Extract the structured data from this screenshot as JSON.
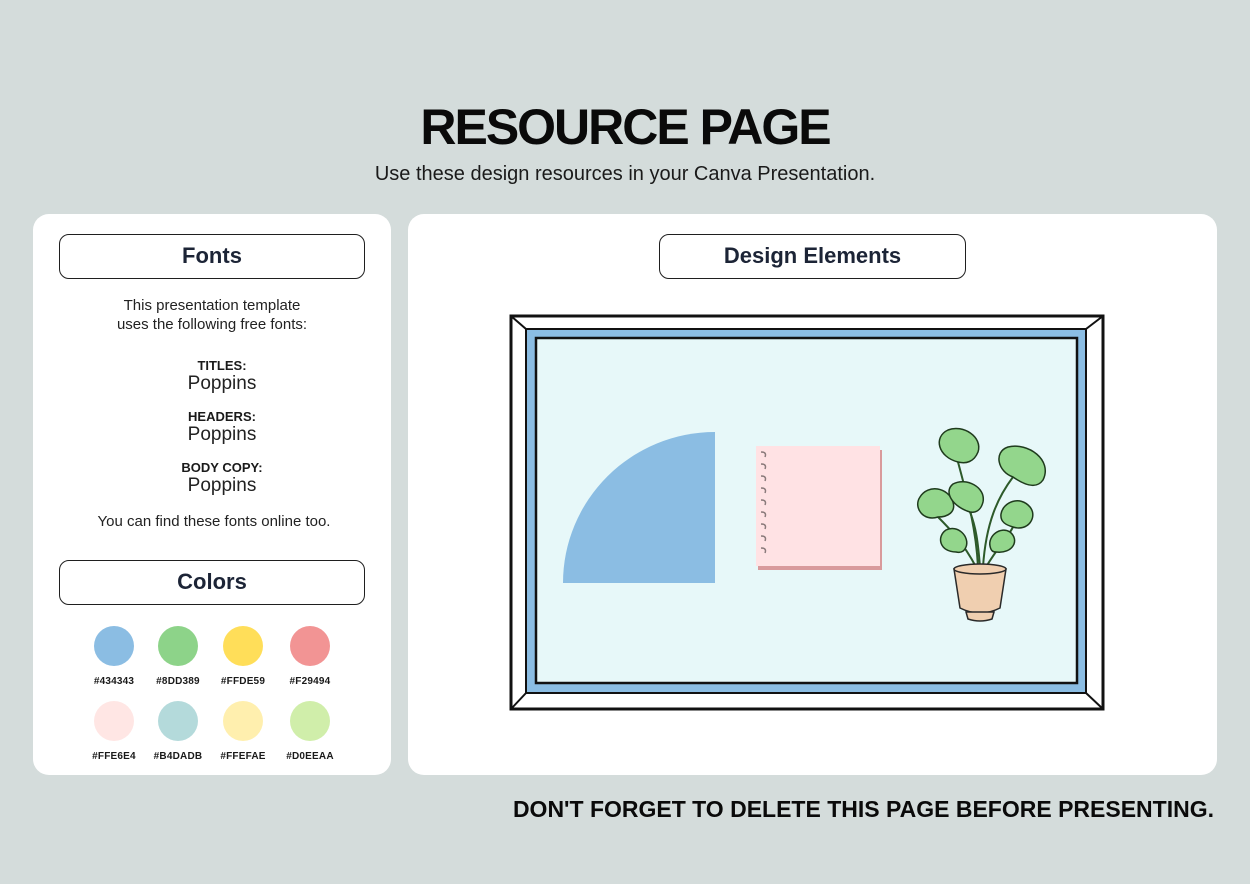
{
  "page": {
    "title": "RESOURCE PAGE",
    "subtitle": "Use these design resources in your Canva Presentation.",
    "footer": "DON'T FORGET TO DELETE THIS PAGE BEFORE PRESENTING."
  },
  "fonts": {
    "header": "Fonts",
    "intro_line1": "This presentation template",
    "intro_line2": "uses the following free fonts:",
    "entries": [
      {
        "label": "TITLES:",
        "name": "Poppins"
      },
      {
        "label": "HEADERS:",
        "name": "Poppins"
      },
      {
        "label": "BODY COPY:",
        "name": "Poppins"
      }
    ],
    "note": "You can find these fonts online too."
  },
  "colors": {
    "header": "Colors",
    "swatches": [
      {
        "hex": "#434343",
        "color": "#8bbde3"
      },
      {
        "hex": "#8DD389",
        "color": "#8dd389"
      },
      {
        "hex": "#FFDE59",
        "color": "#ffde59"
      },
      {
        "hex": "#F29494",
        "color": "#f29494"
      },
      {
        "hex": "#FFE6E4",
        "color": "#ffe6e4"
      },
      {
        "hex": "#B4DADB",
        "color": "#b4dadb"
      },
      {
        "hex": "#FFEFAE",
        "color": "#ffefae"
      },
      {
        "hex": "#D0EEAA",
        "color": "#d0eeaa"
      }
    ]
  },
  "design": {
    "header": "Design Elements",
    "elements": [
      "window-frame",
      "quarter-circle",
      "notepad",
      "potted-plant"
    ]
  }
}
